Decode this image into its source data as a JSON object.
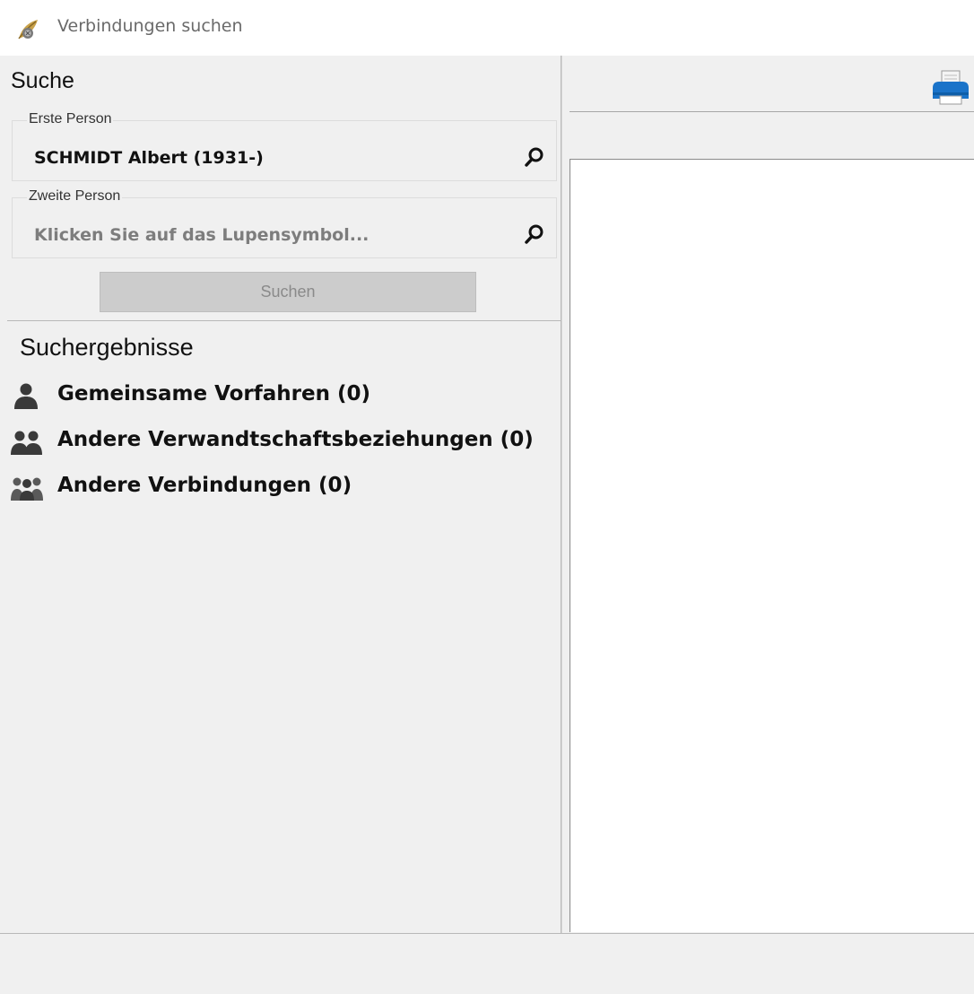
{
  "window": {
    "title": "Verbindungen suchen",
    "icon": "app-feather-icon"
  },
  "search": {
    "heading": "Suche",
    "first_person": {
      "label": "Erste Person",
      "value": "SCHMIDT Albert (1931-)",
      "icon": "magnifier-icon"
    },
    "second_person": {
      "label": "Zweite Person",
      "placeholder": "Klicken Sie auf das Lupensymbol...",
      "icon": "magnifier-icon"
    },
    "button_label": "Suchen"
  },
  "results": {
    "heading": "Suchergebnisse",
    "items": [
      {
        "label": "Gemeinsame Vorfahren (0)",
        "icon": "person-icon"
      },
      {
        "label": "Andere Verwandtschaftsbeziehungen (0)",
        "icon": "two-persons-icon"
      },
      {
        "label": "Andere Verbindungen (0)",
        "icon": "group-icon"
      }
    ]
  },
  "toolbar": {
    "print_icon": "printer-icon"
  },
  "colors": {
    "window_bg": "#f0f0f0",
    "canvas_bg": "#ffffff",
    "printer_blue": "#1a73c9",
    "icon_gray": "#3a3a3a",
    "disabled_text": "#8a8a8a"
  }
}
